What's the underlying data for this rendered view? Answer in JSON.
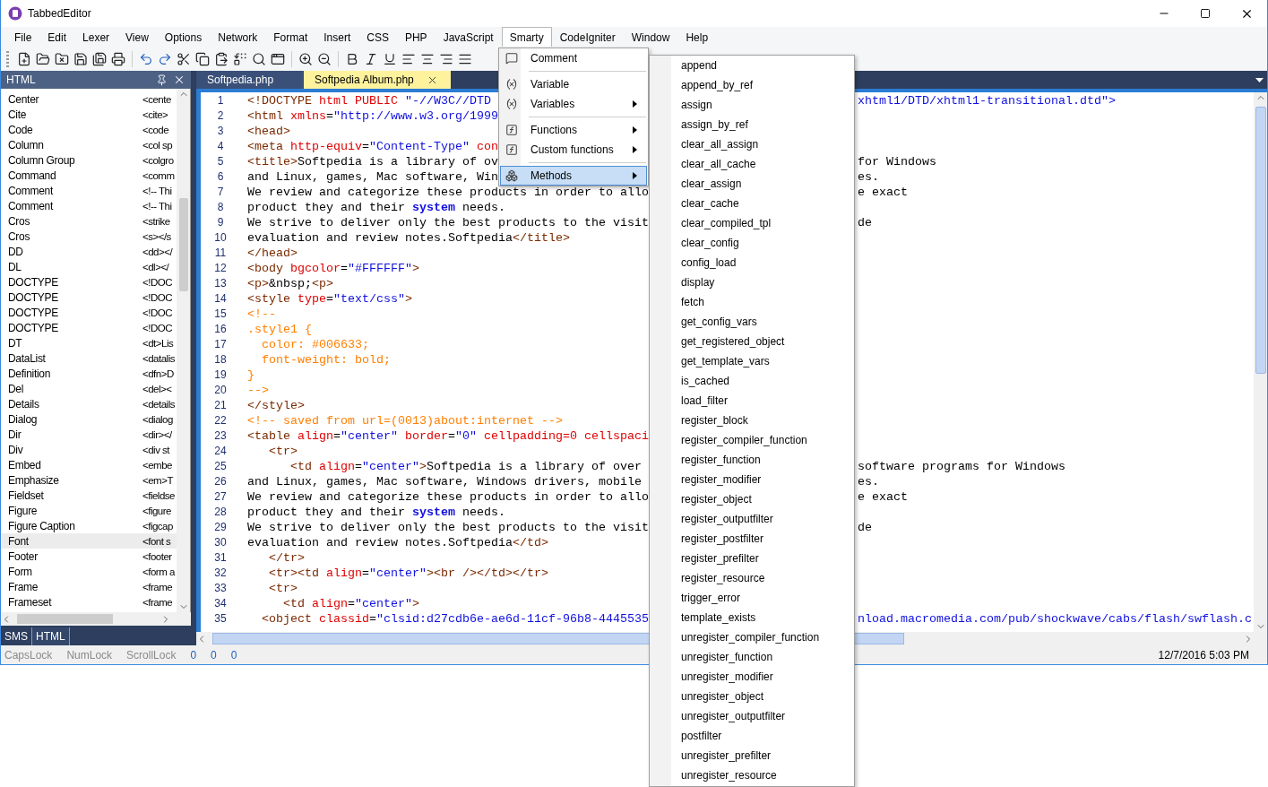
{
  "window": {
    "title": "TabbedEditor"
  },
  "menubar": [
    {
      "label": "File",
      "selected": false
    },
    {
      "label": "Edit",
      "selected": false
    },
    {
      "label": "Lexer",
      "selected": false
    },
    {
      "label": "View",
      "selected": false
    },
    {
      "label": "Options",
      "selected": false
    },
    {
      "label": "Network",
      "selected": false
    },
    {
      "label": "Format",
      "selected": false
    },
    {
      "label": "Insert",
      "selected": false
    },
    {
      "label": "CSS",
      "selected": false
    },
    {
      "label": "PHP",
      "selected": false
    },
    {
      "label": "JavaScript",
      "selected": false
    },
    {
      "label": "Smarty",
      "selected": true
    },
    {
      "label": "CodeIgniter",
      "selected": false
    },
    {
      "label": "Window",
      "selected": false
    },
    {
      "label": "Help",
      "selected": false
    }
  ],
  "side_panel": {
    "title": "HTML",
    "items": [
      {
        "name": "Center",
        "snippet": "<cente",
        "selected": false
      },
      {
        "name": "Cite",
        "snippet": "<cite>",
        "selected": false
      },
      {
        "name": "Code",
        "snippet": "<code",
        "selected": false
      },
      {
        "name": "Column",
        "snippet": "<col sp",
        "selected": false
      },
      {
        "name": "Column Group",
        "snippet": "<colgro",
        "selected": false
      },
      {
        "name": "Command",
        "snippet": "<comm",
        "selected": false
      },
      {
        "name": "Comment",
        "snippet": "<!-- Thi",
        "selected": false
      },
      {
        "name": "Comment",
        "snippet": "<!-- Thi",
        "selected": false
      },
      {
        "name": "Cros",
        "snippet": "<strike",
        "selected": false
      },
      {
        "name": "Cros",
        "snippet": "<s></s",
        "selected": false
      },
      {
        "name": "DD",
        "snippet": "<dd></",
        "selected": false
      },
      {
        "name": "DL",
        "snippet": "<dl></",
        "selected": false
      },
      {
        "name": "DOCTYPE",
        "snippet": "<!DOC",
        "selected": false
      },
      {
        "name": "DOCTYPE",
        "snippet": "<!DOC",
        "selected": false
      },
      {
        "name": "DOCTYPE",
        "snippet": "<!DOC",
        "selected": false
      },
      {
        "name": "DOCTYPE",
        "snippet": "<!DOC",
        "selected": false
      },
      {
        "name": "DT",
        "snippet": "<dt>Lis",
        "selected": false
      },
      {
        "name": "DataList",
        "snippet": "<datalis",
        "selected": false
      },
      {
        "name": "Definition",
        "snippet": "<dfn>D",
        "selected": false
      },
      {
        "name": "Del",
        "snippet": "<del><",
        "selected": false
      },
      {
        "name": "Details",
        "snippet": "<details",
        "selected": false
      },
      {
        "name": "Dialog",
        "snippet": "<dialog",
        "selected": false
      },
      {
        "name": "Dir",
        "snippet": "<dir></",
        "selected": false
      },
      {
        "name": "Div",
        "snippet": "<div st",
        "selected": false
      },
      {
        "name": "Embed",
        "snippet": "<embe",
        "selected": false
      },
      {
        "name": "Emphasize",
        "snippet": "<em>T",
        "selected": false
      },
      {
        "name": "Fieldset",
        "snippet": "<fieldse",
        "selected": false
      },
      {
        "name": "Figure",
        "snippet": "<figure",
        "selected": false
      },
      {
        "name": "Figure Caption",
        "snippet": "<figcap",
        "selected": false
      },
      {
        "name": "Font",
        "snippet": "<font s",
        "selected": true
      },
      {
        "name": "Footer",
        "snippet": "<footer",
        "selected": false
      },
      {
        "name": "Form",
        "snippet": "<form a",
        "selected": false
      },
      {
        "name": "Frame",
        "snippet": "<frame",
        "selected": false
      },
      {
        "name": "Frameset",
        "snippet": "<frame",
        "selected": false
      }
    ],
    "tabs": [
      {
        "label": "SMS",
        "selected": false
      },
      {
        "label": "HTML",
        "selected": true
      }
    ]
  },
  "editor": {
    "tabs": [
      {
        "label": "Softpedia.php",
        "selected": false
      },
      {
        "label": "Softpedia Album.php",
        "selected": true
      }
    ],
    "lines": [
      {
        "number": "1",
        "tokens": [
          {
            "kind": "tag",
            "text": "<!DOCTYPE "
          },
          {
            "kind": "attr",
            "text": "html PUBLIC "
          },
          {
            "kind": "value",
            "text": "\"-//W3C//DTD"
          }
        ],
        "right": [
          {
            "kind": "value",
            "text": "xhtml1/DTD/xhtml1-transitional.dtd\">"
          }
        ]
      },
      {
        "number": "2",
        "tokens": [
          {
            "kind": "tag",
            "text": "<html "
          },
          {
            "kind": "attr",
            "text": "xmlns"
          },
          {
            "kind": "text",
            "text": "="
          },
          {
            "kind": "value",
            "text": "\"http://www.w3.org/1999"
          }
        ]
      },
      {
        "number": "3",
        "tokens": [
          {
            "kind": "tag",
            "text": "<head>"
          }
        ]
      },
      {
        "number": "4",
        "tokens": [
          {
            "kind": "tag",
            "text": "<meta "
          },
          {
            "kind": "attr",
            "text": "http-equiv"
          },
          {
            "kind": "text",
            "text": "="
          },
          {
            "kind": "value",
            "text": "\"Content-Type\""
          },
          {
            "kind": "attr",
            "text": " con"
          }
        ]
      },
      {
        "number": "5",
        "tokens": [
          {
            "kind": "tag",
            "text": "<title>"
          },
          {
            "kind": "text",
            "text": "Softpedia is a library of ov"
          }
        ],
        "right": [
          {
            "kind": "text",
            "text": "for Windows"
          }
        ]
      },
      {
        "number": "6",
        "tokens": [
          {
            "kind": "text",
            "text": "and Linux, games, Mac software, Win"
          }
        ],
        "right": [
          {
            "kind": "text",
            "text": "es."
          }
        ]
      },
      {
        "number": "7",
        "tokens": [
          {
            "kind": "text",
            "text": "We review and categorize these products in order to allo"
          }
        ],
        "right": [
          {
            "kind": "text",
            "text": "e exact"
          }
        ]
      },
      {
        "number": "8",
        "tokens": [
          {
            "kind": "text",
            "text": "product they and their "
          },
          {
            "kind": "keyword",
            "text": "system"
          },
          {
            "kind": "text",
            "text": " needs."
          }
        ]
      },
      {
        "number": "9",
        "tokens": [
          {
            "kind": "text",
            "text": "We strive to deliver only the best products to the visit"
          }
        ],
        "right": [
          {
            "kind": "text",
            "text": "de"
          }
        ]
      },
      {
        "number": "10",
        "tokens": [
          {
            "kind": "text",
            "text": "evaluation and review notes.Softpedia"
          },
          {
            "kind": "tag",
            "text": "</title>"
          }
        ]
      },
      {
        "number": "11",
        "tokens": [
          {
            "kind": "tag",
            "text": "</head>"
          }
        ]
      },
      {
        "number": "12",
        "tokens": [
          {
            "kind": "tag",
            "text": "<body "
          },
          {
            "kind": "attr",
            "text": "bgcolor"
          },
          {
            "kind": "text",
            "text": "="
          },
          {
            "kind": "value",
            "text": "\"#FFFFFF\""
          },
          {
            "kind": "tag",
            "text": ">"
          }
        ]
      },
      {
        "number": "13",
        "tokens": [
          {
            "kind": "tag",
            "text": "<p>"
          },
          {
            "kind": "text",
            "text": "&nbsp;"
          },
          {
            "kind": "tag",
            "text": "<p>"
          }
        ]
      },
      {
        "number": "14",
        "tokens": [
          {
            "kind": "tag",
            "text": "<style "
          },
          {
            "kind": "attr",
            "text": "type"
          },
          {
            "kind": "text",
            "text": "="
          },
          {
            "kind": "value",
            "text": "\"text/css\""
          },
          {
            "kind": "tag",
            "text": ">"
          }
        ]
      },
      {
        "number": "15",
        "tokens": [
          {
            "kind": "comment",
            "text": "<!--"
          }
        ]
      },
      {
        "number": "16",
        "tokens": [
          {
            "kind": "comment",
            "text": ".style1 {"
          }
        ]
      },
      {
        "number": "17",
        "tokens": [
          {
            "kind": "comment",
            "text": "  color: #006633;"
          }
        ]
      },
      {
        "number": "18",
        "tokens": [
          {
            "kind": "comment",
            "text": "  font-weight: bold;"
          }
        ]
      },
      {
        "number": "19",
        "tokens": [
          {
            "kind": "comment",
            "text": "}"
          }
        ]
      },
      {
        "number": "20",
        "tokens": [
          {
            "kind": "comment",
            "text": "-->"
          }
        ]
      },
      {
        "number": "21",
        "tokens": [
          {
            "kind": "tag",
            "text": "</style>"
          }
        ]
      },
      {
        "number": "22",
        "tokens": [
          {
            "kind": "comment",
            "text": "<!-- saved from url=(0013)about:internet -->"
          }
        ]
      },
      {
        "number": "23",
        "tokens": [
          {
            "kind": "tag",
            "text": "<table "
          },
          {
            "kind": "attr",
            "text": "align"
          },
          {
            "kind": "text",
            "text": "="
          },
          {
            "kind": "value",
            "text": "\"center\""
          },
          {
            "kind": "attr",
            "text": " border"
          },
          {
            "kind": "text",
            "text": "="
          },
          {
            "kind": "value",
            "text": "\"0\""
          },
          {
            "kind": "attr",
            "text": " cellpadding=0 cellspaci"
          }
        ]
      },
      {
        "number": "24",
        "tokens": [
          {
            "kind": "tag",
            "text": "   <tr>"
          }
        ]
      },
      {
        "number": "25",
        "tokens": [
          {
            "kind": "tag",
            "text": "      <td "
          },
          {
            "kind": "attr",
            "text": "align"
          },
          {
            "kind": "text",
            "text": "="
          },
          {
            "kind": "value",
            "text": "\"center\""
          },
          {
            "kind": "tag",
            "text": ">"
          },
          {
            "kind": "text",
            "text": "Softpedia is a library of over"
          }
        ],
        "right": [
          {
            "kind": "text",
            "text": "software programs for Windows"
          }
        ]
      },
      {
        "number": "26",
        "tokens": [
          {
            "kind": "text",
            "text": "and Linux, games, Mac software, Windows drivers, mobile"
          }
        ],
        "right": [
          {
            "kind": "text",
            "text": "es."
          }
        ]
      },
      {
        "number": "27",
        "tokens": [
          {
            "kind": "text",
            "text": "We review and categorize these products in order to allo"
          }
        ],
        "right": [
          {
            "kind": "text",
            "text": "e exact"
          }
        ]
      },
      {
        "number": "28",
        "tokens": [
          {
            "kind": "text",
            "text": "product they and their "
          },
          {
            "kind": "keyword",
            "text": "system"
          },
          {
            "kind": "text",
            "text": " needs."
          }
        ]
      },
      {
        "number": "29",
        "tokens": [
          {
            "kind": "text",
            "text": "We strive to deliver only the best products to the visit"
          }
        ],
        "right": [
          {
            "kind": "text",
            "text": "de"
          }
        ]
      },
      {
        "number": "30",
        "tokens": [
          {
            "kind": "text",
            "text": "evaluation and review notes.Softpedia"
          },
          {
            "kind": "tag",
            "text": "</td>"
          }
        ]
      },
      {
        "number": "31",
        "tokens": [
          {
            "kind": "tag",
            "text": "   </tr>"
          }
        ]
      },
      {
        "number": "32",
        "tokens": [
          {
            "kind": "tag",
            "text": "   <tr><td "
          },
          {
            "kind": "attr",
            "text": "align"
          },
          {
            "kind": "text",
            "text": "="
          },
          {
            "kind": "value",
            "text": "\"center\""
          },
          {
            "kind": "tag",
            "text": "><br /></td></tr>"
          }
        ]
      },
      {
        "number": "33",
        "tokens": [
          {
            "kind": "tag",
            "text": "   <tr>"
          }
        ]
      },
      {
        "number": "34",
        "tokens": [
          {
            "kind": "tag",
            "text": "     <td "
          },
          {
            "kind": "attr",
            "text": "align"
          },
          {
            "kind": "text",
            "text": "="
          },
          {
            "kind": "value",
            "text": "\"center\""
          },
          {
            "kind": "tag",
            "text": ">"
          }
        ]
      },
      {
        "number": "35",
        "tokens": [
          {
            "kind": "tag",
            "text": "  <object "
          },
          {
            "kind": "attr",
            "text": "classid"
          },
          {
            "kind": "text",
            "text": "="
          },
          {
            "kind": "value",
            "text": "\"clsid:d27cdb6e-ae6d-11cf-96b8-4445535"
          }
        ],
        "right": [
          {
            "kind": "value",
            "text": "nload.macromedia.com/pub/shockwave/cabs/flash/swflash.c"
          }
        ]
      }
    ]
  },
  "smarty_menu": {
    "groups": [
      [
        {
          "label": "Comment",
          "kind": "comment",
          "submenu": false,
          "selected": false
        }
      ],
      [
        {
          "label": "Variable",
          "kind": "variable",
          "submenu": false,
          "selected": false
        },
        {
          "label": "Variables",
          "kind": "variable",
          "submenu": true,
          "selected": false
        }
      ],
      [
        {
          "label": "Functions",
          "kind": "function",
          "submenu": true,
          "selected": false
        },
        {
          "label": "Custom functions",
          "kind": "function",
          "submenu": true,
          "selected": false
        }
      ],
      [
        {
          "label": "Methods",
          "kind": "method",
          "submenu": true,
          "selected": true
        }
      ]
    ]
  },
  "methods_submenu": {
    "items": [
      "append",
      "append_by_ref",
      "assign",
      "assign_by_ref",
      "clear_all_assign",
      "clear_all_cache",
      "clear_assign",
      "clear_cache",
      "clear_compiled_tpl",
      "clear_config",
      "config_load",
      "display",
      "fetch",
      "get_config_vars",
      "get_registered_object",
      "get_template_vars",
      "is_cached",
      "load_filter",
      "register_block",
      "register_compiler_function",
      "register_function",
      "register_modifier",
      "register_object",
      "register_outputfilter",
      "register_postfilter",
      "register_prefilter",
      "register_resource",
      "trigger_error",
      "template_exists",
      "unregister_compiler_function",
      "unregister_function",
      "unregister_modifier",
      "unregister_object",
      "unregister_outputfilter",
      "postfilter",
      "unregister_prefilter",
      "unregister_resource"
    ]
  },
  "status_bar": {
    "locks": [
      {
        "label": "CapsLock",
        "on": false
      },
      {
        "label": "NumLock",
        "on": false
      },
      {
        "label": "ScrollLock",
        "on": false
      }
    ],
    "counters": [
      "0",
      "0",
      "0"
    ],
    "datetime": "12/7/2016 5:03 PM"
  }
}
